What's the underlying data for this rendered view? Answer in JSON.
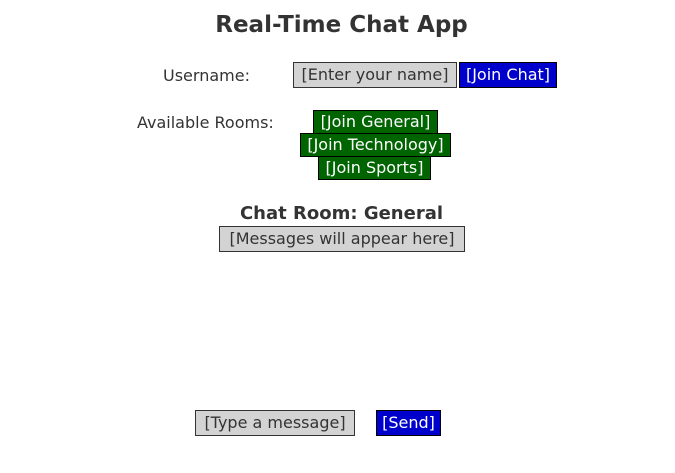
{
  "app": {
    "title": "Real-Time Chat App"
  },
  "login": {
    "username_label": "Username:",
    "username_placeholder": "[Enter your name]",
    "join_chat_label": "[Join Chat]"
  },
  "rooms": {
    "label": "Available Rooms:",
    "items": [
      {
        "label": "[Join General]"
      },
      {
        "label": "[Join Technology]"
      },
      {
        "label": "[Join Sports]"
      }
    ]
  },
  "chat": {
    "room_title": "Chat Room: General",
    "messages_placeholder": "[Messages will appear here]",
    "message_placeholder": "[Type a message]",
    "send_label": "[Send]"
  },
  "colors": {
    "button_blue": "#0000cc",
    "button_green": "#006400",
    "input_gray": "#d3d3d3",
    "text": "#333333"
  }
}
